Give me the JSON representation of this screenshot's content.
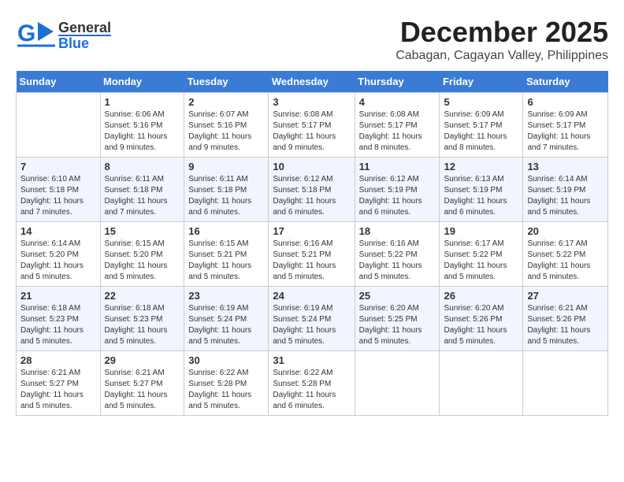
{
  "header": {
    "logo_general": "General",
    "logo_blue": "Blue",
    "month_title": "December 2025",
    "location": "Cabagan, Cagayan Valley, Philippines"
  },
  "weekdays": [
    "Sunday",
    "Monday",
    "Tuesday",
    "Wednesday",
    "Thursday",
    "Friday",
    "Saturday"
  ],
  "weeks": [
    [
      {
        "day": "",
        "sunrise": "",
        "sunset": "",
        "daylight": ""
      },
      {
        "day": "1",
        "sunrise": "Sunrise: 6:06 AM",
        "sunset": "Sunset: 5:16 PM",
        "daylight": "Daylight: 11 hours and 9 minutes."
      },
      {
        "day": "2",
        "sunrise": "Sunrise: 6:07 AM",
        "sunset": "Sunset: 5:16 PM",
        "daylight": "Daylight: 11 hours and 9 minutes."
      },
      {
        "day": "3",
        "sunrise": "Sunrise: 6:08 AM",
        "sunset": "Sunset: 5:17 PM",
        "daylight": "Daylight: 11 hours and 9 minutes."
      },
      {
        "day": "4",
        "sunrise": "Sunrise: 6:08 AM",
        "sunset": "Sunset: 5:17 PM",
        "daylight": "Daylight: 11 hours and 8 minutes."
      },
      {
        "day": "5",
        "sunrise": "Sunrise: 6:09 AM",
        "sunset": "Sunset: 5:17 PM",
        "daylight": "Daylight: 11 hours and 8 minutes."
      },
      {
        "day": "6",
        "sunrise": "Sunrise: 6:09 AM",
        "sunset": "Sunset: 5:17 PM",
        "daylight": "Daylight: 11 hours and 7 minutes."
      }
    ],
    [
      {
        "day": "7",
        "sunrise": "Sunrise: 6:10 AM",
        "sunset": "Sunset: 5:18 PM",
        "daylight": "Daylight: 11 hours and 7 minutes."
      },
      {
        "day": "8",
        "sunrise": "Sunrise: 6:11 AM",
        "sunset": "Sunset: 5:18 PM",
        "daylight": "Daylight: 11 hours and 7 minutes."
      },
      {
        "day": "9",
        "sunrise": "Sunrise: 6:11 AM",
        "sunset": "Sunset: 5:18 PM",
        "daylight": "Daylight: 11 hours and 6 minutes."
      },
      {
        "day": "10",
        "sunrise": "Sunrise: 6:12 AM",
        "sunset": "Sunset: 5:18 PM",
        "daylight": "Daylight: 11 hours and 6 minutes."
      },
      {
        "day": "11",
        "sunrise": "Sunrise: 6:12 AM",
        "sunset": "Sunset: 5:19 PM",
        "daylight": "Daylight: 11 hours and 6 minutes."
      },
      {
        "day": "12",
        "sunrise": "Sunrise: 6:13 AM",
        "sunset": "Sunset: 5:19 PM",
        "daylight": "Daylight: 11 hours and 6 minutes."
      },
      {
        "day": "13",
        "sunrise": "Sunrise: 6:14 AM",
        "sunset": "Sunset: 5:19 PM",
        "daylight": "Daylight: 11 hours and 5 minutes."
      }
    ],
    [
      {
        "day": "14",
        "sunrise": "Sunrise: 6:14 AM",
        "sunset": "Sunset: 5:20 PM",
        "daylight": "Daylight: 11 hours and 5 minutes."
      },
      {
        "day": "15",
        "sunrise": "Sunrise: 6:15 AM",
        "sunset": "Sunset: 5:20 PM",
        "daylight": "Daylight: 11 hours and 5 minutes."
      },
      {
        "day": "16",
        "sunrise": "Sunrise: 6:15 AM",
        "sunset": "Sunset: 5:21 PM",
        "daylight": "Daylight: 11 hours and 5 minutes."
      },
      {
        "day": "17",
        "sunrise": "Sunrise: 6:16 AM",
        "sunset": "Sunset: 5:21 PM",
        "daylight": "Daylight: 11 hours and 5 minutes."
      },
      {
        "day": "18",
        "sunrise": "Sunrise: 6:16 AM",
        "sunset": "Sunset: 5:22 PM",
        "daylight": "Daylight: 11 hours and 5 minutes."
      },
      {
        "day": "19",
        "sunrise": "Sunrise: 6:17 AM",
        "sunset": "Sunset: 5:22 PM",
        "daylight": "Daylight: 11 hours and 5 minutes."
      },
      {
        "day": "20",
        "sunrise": "Sunrise: 6:17 AM",
        "sunset": "Sunset: 5:22 PM",
        "daylight": "Daylight: 11 hours and 5 minutes."
      }
    ],
    [
      {
        "day": "21",
        "sunrise": "Sunrise: 6:18 AM",
        "sunset": "Sunset: 5:23 PM",
        "daylight": "Daylight: 11 hours and 5 minutes."
      },
      {
        "day": "22",
        "sunrise": "Sunrise: 6:18 AM",
        "sunset": "Sunset: 5:23 PM",
        "daylight": "Daylight: 11 hours and 5 minutes."
      },
      {
        "day": "23",
        "sunrise": "Sunrise: 6:19 AM",
        "sunset": "Sunset: 5:24 PM",
        "daylight": "Daylight: 11 hours and 5 minutes."
      },
      {
        "day": "24",
        "sunrise": "Sunrise: 6:19 AM",
        "sunset": "Sunset: 5:24 PM",
        "daylight": "Daylight: 11 hours and 5 minutes."
      },
      {
        "day": "25",
        "sunrise": "Sunrise: 6:20 AM",
        "sunset": "Sunset: 5:25 PM",
        "daylight": "Daylight: 11 hours and 5 minutes."
      },
      {
        "day": "26",
        "sunrise": "Sunrise: 6:20 AM",
        "sunset": "Sunset: 5:26 PM",
        "daylight": "Daylight: 11 hours and 5 minutes."
      },
      {
        "day": "27",
        "sunrise": "Sunrise: 6:21 AM",
        "sunset": "Sunset: 5:26 PM",
        "daylight": "Daylight: 11 hours and 5 minutes."
      }
    ],
    [
      {
        "day": "28",
        "sunrise": "Sunrise: 6:21 AM",
        "sunset": "Sunset: 5:27 PM",
        "daylight": "Daylight: 11 hours and 5 minutes."
      },
      {
        "day": "29",
        "sunrise": "Sunrise: 6:21 AM",
        "sunset": "Sunset: 5:27 PM",
        "daylight": "Daylight: 11 hours and 5 minutes."
      },
      {
        "day": "30",
        "sunrise": "Sunrise: 6:22 AM",
        "sunset": "Sunset: 5:28 PM",
        "daylight": "Daylight: 11 hours and 5 minutes."
      },
      {
        "day": "31",
        "sunrise": "Sunrise: 6:22 AM",
        "sunset": "Sunset: 5:28 PM",
        "daylight": "Daylight: 11 hours and 6 minutes."
      },
      {
        "day": "",
        "sunrise": "",
        "sunset": "",
        "daylight": ""
      },
      {
        "day": "",
        "sunrise": "",
        "sunset": "",
        "daylight": ""
      },
      {
        "day": "",
        "sunrise": "",
        "sunset": "",
        "daylight": ""
      }
    ]
  ]
}
